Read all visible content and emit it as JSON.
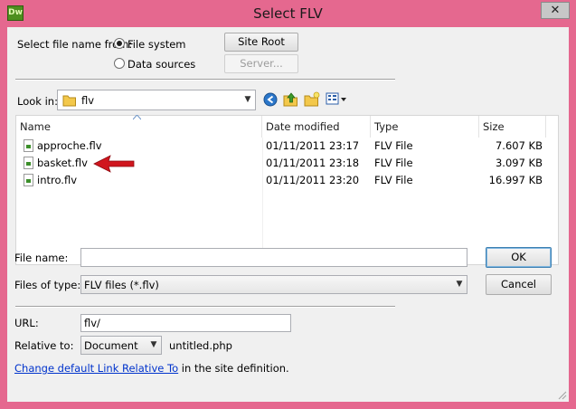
{
  "window": {
    "title": "Select FLV",
    "app_icon_text": "Dw",
    "close_glyph": "✕"
  },
  "source": {
    "label": "Select file name from:",
    "options": [
      "File system",
      "Data sources"
    ],
    "selected": "File system",
    "site_root_label": "Site Root",
    "server_label": "Server..."
  },
  "lookin": {
    "label": "Look in:",
    "value": "flv"
  },
  "toolbar": {
    "icons": [
      "back-icon",
      "up-folder-icon",
      "new-folder-icon",
      "view-menu-icon"
    ]
  },
  "files": {
    "columns": [
      "Name",
      "Date modified",
      "Type",
      "Size"
    ],
    "rows": [
      {
        "name": "approche.flv",
        "date": "01/11/2011 23:17",
        "type": "FLV File",
        "size": "7.607 KB"
      },
      {
        "name": "basket.flv",
        "date": "01/11/2011 23:18",
        "type": "FLV File",
        "size": "3.097 KB"
      },
      {
        "name": "intro.flv",
        "date": "01/11/2011 23:20",
        "type": "FLV File",
        "size": "16.997 KB"
      }
    ]
  },
  "filename": {
    "label": "File name:",
    "value": ""
  },
  "filetype": {
    "label": "Files of type:",
    "value": "FLV files (*.flv)"
  },
  "buttons": {
    "ok": "OK",
    "cancel": "Cancel"
  },
  "url": {
    "label": "URL:",
    "value": "flv/"
  },
  "relative": {
    "label": "Relative to:",
    "value": "Document",
    "file": "untitled.php"
  },
  "footer": {
    "link": "Change default Link Relative To",
    "rest": " in the site definition."
  },
  "colors": {
    "frame": "#e5688f",
    "annotation_arrow": "#d0161e"
  }
}
